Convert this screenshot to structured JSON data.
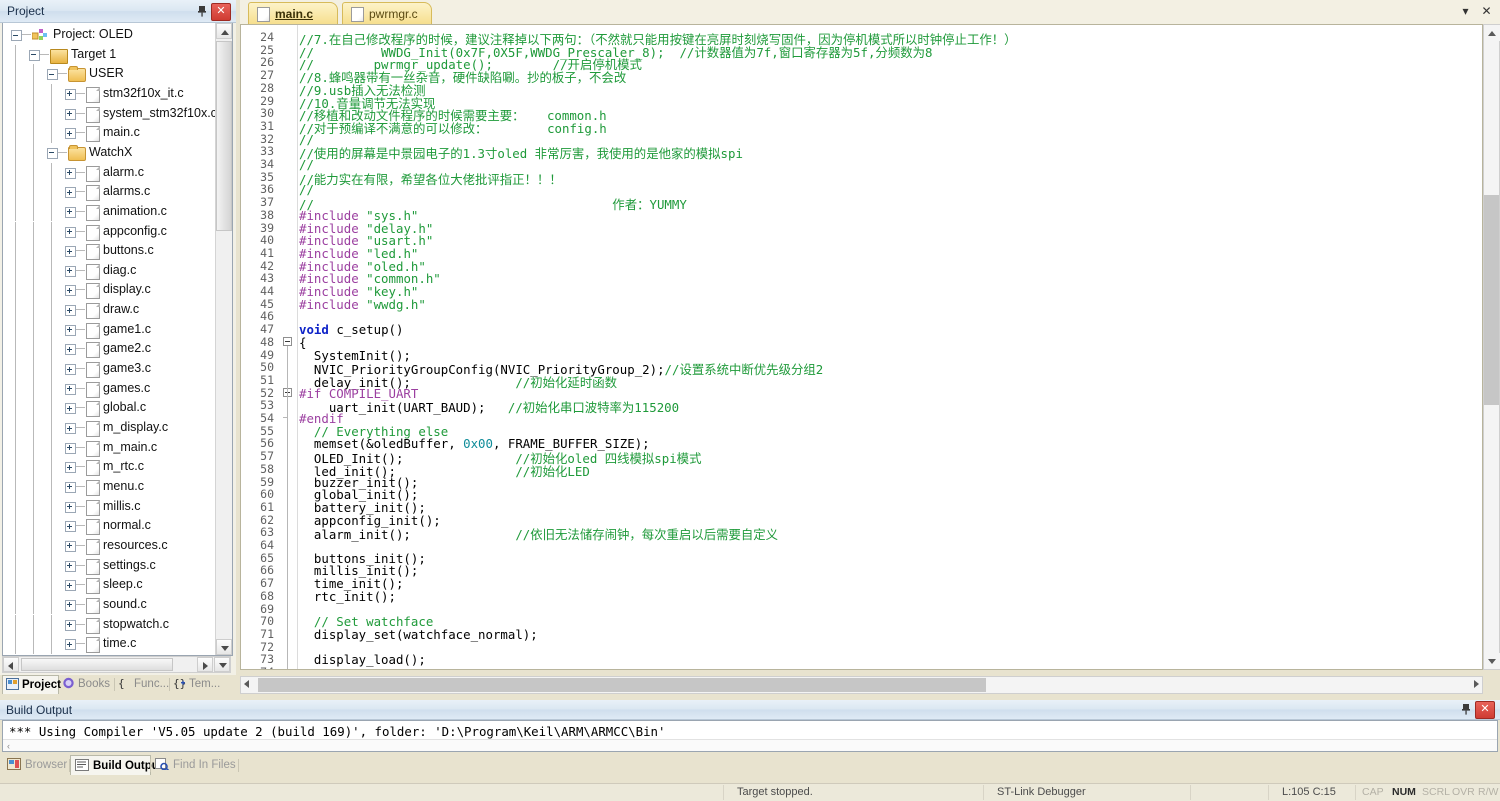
{
  "project_panel": {
    "title": "Project",
    "pin_icon": "pin-icon",
    "close_icon": "close-icon",
    "tree": [
      {
        "label": "Project: OLED",
        "depth": 0,
        "icon": "project-icon",
        "expander": "minus"
      },
      {
        "label": "Target 1",
        "depth": 1,
        "icon": "target-icon",
        "expander": "minus"
      },
      {
        "label": "USER",
        "depth": 2,
        "icon": "folder-icon",
        "expander": "minus"
      },
      {
        "label": "stm32f10x_it.c",
        "depth": 3,
        "icon": "file-icon",
        "expander": "plus"
      },
      {
        "label": "system_stm32f10x.c",
        "depth": 3,
        "icon": "file-icon",
        "expander": "plus"
      },
      {
        "label": "main.c",
        "depth": 3,
        "icon": "file-icon",
        "expander": "plus"
      },
      {
        "label": "WatchX",
        "depth": 2,
        "icon": "folder-icon",
        "expander": "minus"
      },
      {
        "label": "alarm.c",
        "depth": 3,
        "icon": "file-icon",
        "expander": "plus"
      },
      {
        "label": "alarms.c",
        "depth": 3,
        "icon": "file-icon",
        "expander": "plus"
      },
      {
        "label": "animation.c",
        "depth": 3,
        "icon": "file-icon",
        "expander": "plus"
      },
      {
        "label": "appconfig.c",
        "depth": 3,
        "icon": "file-icon",
        "expander": "plus"
      },
      {
        "label": "buttons.c",
        "depth": 3,
        "icon": "file-icon",
        "expander": "plus"
      },
      {
        "label": "diag.c",
        "depth": 3,
        "icon": "file-icon",
        "expander": "plus"
      },
      {
        "label": "display.c",
        "depth": 3,
        "icon": "file-icon",
        "expander": "plus"
      },
      {
        "label": "draw.c",
        "depth": 3,
        "icon": "file-icon",
        "expander": "plus"
      },
      {
        "label": "game1.c",
        "depth": 3,
        "icon": "file-icon",
        "expander": "plus"
      },
      {
        "label": "game2.c",
        "depth": 3,
        "icon": "file-icon",
        "expander": "plus"
      },
      {
        "label": "game3.c",
        "depth": 3,
        "icon": "file-icon",
        "expander": "plus"
      },
      {
        "label": "games.c",
        "depth": 3,
        "icon": "file-icon",
        "expander": "plus"
      },
      {
        "label": "global.c",
        "depth": 3,
        "icon": "file-icon",
        "expander": "plus"
      },
      {
        "label": "m_display.c",
        "depth": 3,
        "icon": "file-icon",
        "expander": "plus"
      },
      {
        "label": "m_main.c",
        "depth": 3,
        "icon": "file-icon",
        "expander": "plus"
      },
      {
        "label": "m_rtc.c",
        "depth": 3,
        "icon": "file-icon",
        "expander": "plus"
      },
      {
        "label": "menu.c",
        "depth": 3,
        "icon": "file-icon",
        "expander": "plus"
      },
      {
        "label": "millis.c",
        "depth": 3,
        "icon": "file-icon",
        "expander": "plus"
      },
      {
        "label": "normal.c",
        "depth": 3,
        "icon": "file-icon",
        "expander": "plus"
      },
      {
        "label": "resources.c",
        "depth": 3,
        "icon": "file-icon",
        "expander": "plus"
      },
      {
        "label": "settings.c",
        "depth": 3,
        "icon": "file-icon",
        "expander": "plus"
      },
      {
        "label": "sleep.c",
        "depth": 3,
        "icon": "file-icon",
        "expander": "plus"
      },
      {
        "label": "sound.c",
        "depth": 3,
        "icon": "file-icon",
        "expander": "plus"
      },
      {
        "label": "stopwatch.c",
        "depth": 3,
        "icon": "file-icon",
        "expander": "plus"
      },
      {
        "label": "time.c",
        "depth": 3,
        "icon": "file-icon",
        "expander": "plus"
      }
    ],
    "bottom_tabs": [
      {
        "label": "Project",
        "icon": "project-tab-icon",
        "active": true
      },
      {
        "label": "Books",
        "icon": "books-icon",
        "active": false
      },
      {
        "label": "Func...",
        "icon": "functions-icon",
        "active": false
      },
      {
        "label": "Tem...",
        "icon": "templates-icon",
        "active": false
      }
    ]
  },
  "editor": {
    "tabs": [
      {
        "label": "main.c",
        "active": true
      },
      {
        "label": "pwrmgr.c",
        "active": false
      }
    ],
    "window_menu_icon": "chevron-down-icon",
    "window_close_icon": "close-icon",
    "first_line_number": 24,
    "lines": [
      {
        "n": 24,
        "segs": [
          {
            "t": "//7.在自己修改程序的时候，建议注释掉以下两句：（不然就只能用按键在亮屏时刻烧写固件，因为停机模式所以时钟停止工作！）",
            "c": "cm"
          }
        ]
      },
      {
        "n": 25,
        "segs": [
          {
            "t": "//         WWDG_Init(0x7F,0X5F,WWDG_Prescaler_8);  //计数器值为7f,窗口寄存器为5f,分频数为8",
            "c": "cm"
          }
        ]
      },
      {
        "n": 26,
        "segs": [
          {
            "t": "//        pwrmgr_update();        //开启停机模式",
            "c": "cm"
          }
        ]
      },
      {
        "n": 27,
        "segs": [
          {
            "t": "//8.蜂鸣器带有一丝杂音，硬件缺陷唰。抄的板子，不会改",
            "c": "cm"
          }
        ]
      },
      {
        "n": 28,
        "segs": [
          {
            "t": "//9.usb插入无法检测",
            "c": "cm"
          }
        ]
      },
      {
        "n": 29,
        "segs": [
          {
            "t": "//10.音量调节无法实现",
            "c": "cm"
          }
        ]
      },
      {
        "n": 30,
        "segs": [
          {
            "t": "//移植和改动文件程序的时候需要主要：   common.h",
            "c": "cm"
          }
        ]
      },
      {
        "n": 31,
        "segs": [
          {
            "t": "//对于预编译不满意的可以修改：        config.h",
            "c": "cm"
          }
        ]
      },
      {
        "n": 32,
        "segs": [
          {
            "t": "//",
            "c": "cm"
          }
        ]
      },
      {
        "n": 33,
        "segs": [
          {
            "t": "//使用的屏幕是中景园电子的1.3寸oled 非常厉害，我使用的是他家的模拟spi",
            "c": "cm"
          }
        ]
      },
      {
        "n": 34,
        "segs": [
          {
            "t": "//",
            "c": "cm"
          }
        ]
      },
      {
        "n": 35,
        "segs": [
          {
            "t": "//能力实在有限，希望各位大佬批评指正！！！",
            "c": "cm"
          }
        ]
      },
      {
        "n": 36,
        "segs": [
          {
            "t": "//",
            "c": "cm"
          }
        ]
      },
      {
        "n": 37,
        "segs": [
          {
            "t": "//                                        作者：YUMMY",
            "c": "cm"
          }
        ]
      },
      {
        "n": 38,
        "segs": [
          {
            "t": "#include ",
            "c": "pp"
          },
          {
            "t": "\"sys.h\"",
            "c": "cm"
          }
        ]
      },
      {
        "n": 39,
        "segs": [
          {
            "t": "#include ",
            "c": "pp"
          },
          {
            "t": "\"delay.h\"",
            "c": "cm"
          }
        ]
      },
      {
        "n": 40,
        "segs": [
          {
            "t": "#include ",
            "c": "pp"
          },
          {
            "t": "\"usart.h\"",
            "c": "cm"
          }
        ]
      },
      {
        "n": 41,
        "segs": [
          {
            "t": "#include ",
            "c": "pp"
          },
          {
            "t": "\"led.h\"",
            "c": "cm"
          }
        ]
      },
      {
        "n": 42,
        "segs": [
          {
            "t": "#include ",
            "c": "pp"
          },
          {
            "t": "\"oled.h\"",
            "c": "cm"
          }
        ]
      },
      {
        "n": 43,
        "segs": [
          {
            "t": "#include ",
            "c": "pp"
          },
          {
            "t": "\"common.h\"",
            "c": "cm"
          }
        ]
      },
      {
        "n": 44,
        "segs": [
          {
            "t": "#include ",
            "c": "pp"
          },
          {
            "t": "\"key.h\"",
            "c": "cm"
          }
        ]
      },
      {
        "n": 45,
        "segs": [
          {
            "t": "#include ",
            "c": "pp"
          },
          {
            "t": "\"wwdg.h\"",
            "c": "cm"
          }
        ]
      },
      {
        "n": 46,
        "segs": []
      },
      {
        "n": 47,
        "segs": [
          {
            "t": "void ",
            "c": "kw"
          },
          {
            "t": "c_setup()",
            "c": "tx"
          }
        ]
      },
      {
        "n": 48,
        "segs": [
          {
            "t": "{",
            "c": "tx"
          }
        ],
        "fold": "start"
      },
      {
        "n": 49,
        "segs": [
          {
            "t": "  SystemInit();",
            "c": "tx"
          }
        ]
      },
      {
        "n": 50,
        "segs": [
          {
            "t": "  NVIC_PriorityGroupConfig(NVIC_PriorityGroup_2);",
            "c": "tx"
          },
          {
            "t": "//设置系统中断优先级分组2",
            "c": "cm"
          }
        ]
      },
      {
        "n": 51,
        "segs": [
          {
            "t": "  delay_init();              ",
            "c": "tx"
          },
          {
            "t": "//初始化延时函数",
            "c": "cm"
          }
        ]
      },
      {
        "n": 52,
        "segs": [
          {
            "t": "#if COMPILE_UART",
            "c": "pp"
          }
        ],
        "fold": "start"
      },
      {
        "n": 53,
        "segs": [
          {
            "t": "    uart_init(UART_BAUD);   ",
            "c": "tx"
          },
          {
            "t": "//初始化串口波特率为115200",
            "c": "cm"
          }
        ]
      },
      {
        "n": 54,
        "segs": [
          {
            "t": "#endif",
            "c": "pp"
          }
        ],
        "fold": "end"
      },
      {
        "n": 55,
        "segs": [
          {
            "t": "  // Everything else",
            "c": "cm"
          }
        ]
      },
      {
        "n": 56,
        "segs": [
          {
            "t": "  memset(&oledBuffer, ",
            "c": "tx"
          },
          {
            "t": "0x00",
            "c": "nm"
          },
          {
            "t": ", FRAME_BUFFER_SIZE);",
            "c": "tx"
          }
        ]
      },
      {
        "n": 57,
        "segs": [
          {
            "t": "  OLED_Init();               ",
            "c": "tx"
          },
          {
            "t": "//初始化oled 四线模拟spi模式",
            "c": "cm"
          }
        ]
      },
      {
        "n": 58,
        "segs": [
          {
            "t": "  led_init();                ",
            "c": "tx"
          },
          {
            "t": "//初始化LED",
            "c": "cm"
          }
        ]
      },
      {
        "n": 59,
        "segs": [
          {
            "t": "  buzzer_init();",
            "c": "tx"
          }
        ]
      },
      {
        "n": 60,
        "segs": [
          {
            "t": "  global_init();",
            "c": "tx"
          }
        ]
      },
      {
        "n": 61,
        "segs": [
          {
            "t": "  battery_init();",
            "c": "tx"
          }
        ]
      },
      {
        "n": 62,
        "segs": [
          {
            "t": "  appconfig_init();",
            "c": "tx"
          }
        ]
      },
      {
        "n": 63,
        "segs": [
          {
            "t": "  alarm_init();              ",
            "c": "tx"
          },
          {
            "t": "//依旧无法储存闹钟，每次重启以后需要自定义",
            "c": "cm"
          }
        ]
      },
      {
        "n": 64,
        "segs": []
      },
      {
        "n": 65,
        "segs": [
          {
            "t": "  buttons_init();",
            "c": "tx"
          }
        ]
      },
      {
        "n": 66,
        "segs": [
          {
            "t": "  millis_init();",
            "c": "tx"
          }
        ]
      },
      {
        "n": 67,
        "segs": [
          {
            "t": "  time_init();",
            "c": "tx"
          }
        ]
      },
      {
        "n": 68,
        "segs": [
          {
            "t": "  rtc_init();",
            "c": "tx"
          }
        ]
      },
      {
        "n": 69,
        "segs": []
      },
      {
        "n": 70,
        "segs": [
          {
            "t": "  // Set watchface",
            "c": "cm"
          }
        ]
      },
      {
        "n": 71,
        "segs": [
          {
            "t": "  display_set(watchface_normal);",
            "c": "tx"
          }
        ]
      },
      {
        "n": 72,
        "segs": []
      },
      {
        "n": 73,
        "segs": [
          {
            "t": "  display_load();",
            "c": "tx"
          }
        ]
      },
      {
        "n": 74,
        "segs": []
      }
    ]
  },
  "build": {
    "title": "Build Output",
    "pin_icon": "pin-icon",
    "close_icon": "close-icon",
    "output_line": "*** Using Compiler 'V5.05 update 2 (build 169)', folder: 'D:\\Program\\Keil\\ARM\\ARMCC\\Bin'",
    "tabs": [
      {
        "label": "Browser",
        "icon": "browser-icon",
        "active": false
      },
      {
        "label": "Build Output",
        "icon": "build-output-icon",
        "active": true
      },
      {
        "label": "Find In Files",
        "icon": "find-in-files-icon",
        "active": false
      }
    ]
  },
  "statusbar": {
    "target_state": "Target stopped.",
    "debugger": "ST-Link Debugger",
    "cursor_pos": "L:105 C:15",
    "indicators": [
      {
        "label": "CAP",
        "on": false
      },
      {
        "label": "NUM",
        "on": true
      },
      {
        "label": "SCRL",
        "on": false
      },
      {
        "label": "OVR",
        "on": false
      },
      {
        "label": "R/W",
        "on": false
      }
    ]
  },
  "colors": {
    "comment": "#1f9a3a",
    "preprocessor": "#9b3fa0",
    "keyword": "#0d22c8",
    "number": "#0f8c99",
    "tab_active": "#f6df8e",
    "window_chrome": "#e8e3cf"
  }
}
